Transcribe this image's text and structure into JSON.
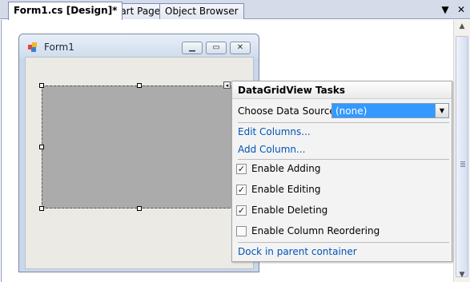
{
  "tabs": [
    {
      "label": "Form1.cs [Design]*",
      "active": true
    },
    {
      "label": "Start Page",
      "active": false
    },
    {
      "label": "Object Browser",
      "active": false
    }
  ],
  "tabstrip_icons": {
    "dropdown": "▼",
    "close": "✕"
  },
  "form": {
    "title": "Form1",
    "caption_buttons": {
      "minimize": "▁",
      "maximize": "▭",
      "close": "✕"
    }
  },
  "smart_tag_glyph": "◂",
  "tasks_panel": {
    "title": "DataGridView Tasks",
    "data_source_label": "Choose Data Source",
    "data_source_value": "(none)",
    "dropdown_glyph": "▼",
    "links": {
      "edit_columns": "Edit Columns...",
      "add_column": "Add Column..."
    },
    "checkboxes": [
      {
        "label": "Enable Adding",
        "checked": true
      },
      {
        "label": "Enable Editing",
        "checked": true
      },
      {
        "label": "Enable Deleting",
        "checked": true
      },
      {
        "label": "Enable Column Reordering",
        "checked": false
      }
    ],
    "dock_link": "Dock in parent container"
  },
  "colors": {
    "selection": "#3399ff",
    "link": "#0053b5",
    "grid_background": "#ababab"
  }
}
